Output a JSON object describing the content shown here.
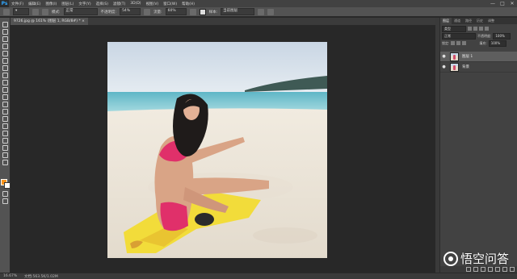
{
  "app": {
    "logo": "Ps"
  },
  "menubar": {
    "items": [
      "文件(F)",
      "编辑(E)",
      "图像(I)",
      "图层(L)",
      "文字(Y)",
      "选择(S)",
      "滤镜(T)",
      "3D(D)",
      "视图(V)",
      "窗口(W)",
      "帮助(H)"
    ]
  },
  "window_controls": [
    "—",
    "□",
    "✕"
  ],
  "options_bar": {
    "mode_label": "模式:",
    "mode_value": "正常",
    "opacity_label": "不透明度:",
    "opacity_value": "54%",
    "flow_label": "流量:",
    "flow_value": "60%",
    "sample_label": "样本:",
    "sample_value": "当前图层"
  },
  "document": {
    "tab_title": "9726.jpg @ 161% (图层 1, RGB/8#) * ×"
  },
  "status": {
    "zoom": "16.67%",
    "doc_info": "文档:563.5K/1.02M"
  },
  "layers_panel": {
    "tabs": [
      "图层",
      "通道",
      "路径",
      "历史",
      "调整"
    ],
    "filter_kind": "类型",
    "blend_mode": "正常",
    "opacity_label": "不透明度:",
    "opacity_value": "100%",
    "lock_label": "锁定:",
    "fill_label": "填充:",
    "fill_value": "100%",
    "layers": [
      {
        "name": "图层 1",
        "selected": true
      },
      {
        "name": "背景",
        "selected": false
      }
    ]
  },
  "colors": {
    "foreground": "#f7941d",
    "background": "#ffffff"
  },
  "watermark": {
    "text": "悟空问答"
  }
}
